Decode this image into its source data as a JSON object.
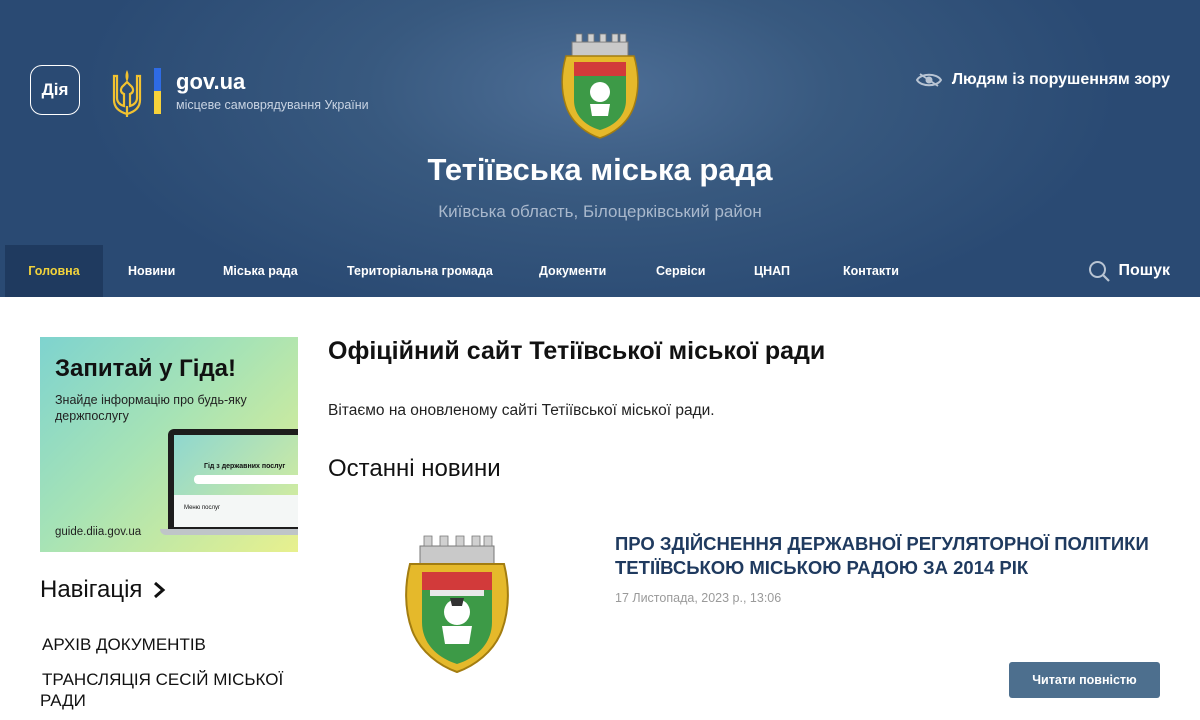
{
  "header": {
    "diia_label": "Дія",
    "gov_title": "gov.ua",
    "gov_subtitle": "місцеве самоврядування України",
    "accessibility_label": "Людям із порушенням зору",
    "site_title": "Тетіївська міська рада",
    "site_subtitle": "Київська область, Білоцерківський район"
  },
  "nav": {
    "items": [
      {
        "label": "Головна",
        "active": true
      },
      {
        "label": "Новини"
      },
      {
        "label": "Міська рада"
      },
      {
        "label": "Територіальна громада"
      },
      {
        "label": "Документи"
      },
      {
        "label": "Сервіси"
      },
      {
        "label": "ЦНАП"
      },
      {
        "label": "Контакти"
      }
    ],
    "search_label": "Пошук"
  },
  "sidebar": {
    "banner": {
      "title": "Запитай у Гіда!",
      "subtitle": "Знайде інформацію про будь-яку держпослугу",
      "url": "guide.diia.gov.ua",
      "screen_text": "Гід з державних послуг",
      "screen_menu": "Меню послуг"
    },
    "nav_heading": "Навігація",
    "links": [
      {
        "label": "Архів документів"
      },
      {
        "label": "Трансляція сесій міської ради"
      }
    ]
  },
  "main": {
    "title": "Офіційний сайт Тетіївської міської ради",
    "intro": "Вітаємо на оновленому сайті Тетіївської міської ради.",
    "news_heading": "Останні новини",
    "news": [
      {
        "title": "Про здійснення державної регуляторної політики Тетіївською міською радою за 2014 рік",
        "date": "17 Листопада, 2023 р., 13:06",
        "read_more": "Читати повністю"
      }
    ]
  },
  "colors": {
    "header_bg": "#2a4a73",
    "nav_active_bg": "#1f3a5f",
    "nav_active_text": "#f2d33b",
    "news_title": "#1f3a5f",
    "button_bg": "#4d6f8e"
  },
  "icons": {
    "coat_of_arms": "coat-of-arms-icon",
    "trident": "trident-icon",
    "vision": "eye-icon",
    "search": "search-icon",
    "chevron": "chevron-right-icon"
  }
}
